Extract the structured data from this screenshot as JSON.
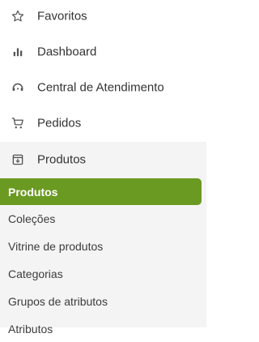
{
  "nav": {
    "items": [
      {
        "label": "Favoritos",
        "icon": "star-icon"
      },
      {
        "label": "Dashboard",
        "icon": "bar-chart-icon"
      },
      {
        "label": "Central de Atendimento",
        "icon": "headset-icon"
      },
      {
        "label": "Pedidos",
        "icon": "cart-icon"
      },
      {
        "label": "Produtos",
        "icon": "product-box-icon"
      }
    ]
  },
  "submenu": {
    "items": [
      {
        "label": "Produtos",
        "active": true
      },
      {
        "label": "Coleções",
        "active": false
      },
      {
        "label": "Vitrine de produtos",
        "active": false
      },
      {
        "label": "Categorias",
        "active": false
      },
      {
        "label": "Grupos de atributos",
        "active": false
      },
      {
        "label": "Atributos",
        "active": false
      }
    ]
  },
  "colors": {
    "active_bg": "#6b9a22",
    "submenu_bg": "#f4f4f4",
    "icon": "#555555",
    "text": "#333333"
  }
}
